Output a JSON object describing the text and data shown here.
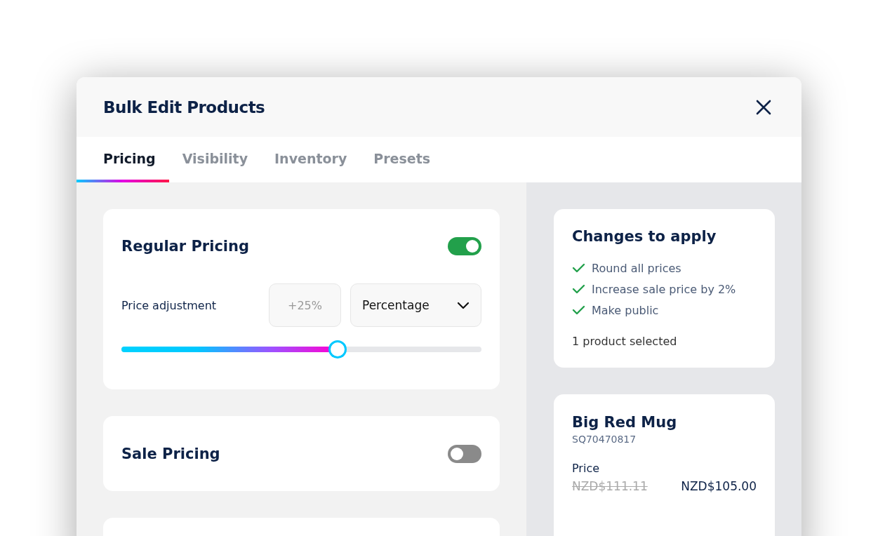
{
  "dialog": {
    "title": "Bulk Edit Products"
  },
  "tabs": [
    {
      "label": "Pricing",
      "selected": true
    },
    {
      "label": "Visibility",
      "selected": false
    },
    {
      "label": "Inventory",
      "selected": false
    },
    {
      "label": "Presets",
      "selected": false
    }
  ],
  "sections": [
    {
      "kind": "adjustment",
      "title": "Regular Pricing",
      "on": true,
      "adjustment_label": "Price adjustment",
      "amount": {
        "placeholder": "+25%"
      },
      "mode": "Percentage",
      "slider": {
        "level": 0.6
      }
    },
    {
      "kind": "toggle",
      "title": "Sale Pricing",
      "on": false
    },
    {
      "kind": "blank"
    }
  ],
  "summary": {
    "title": "Changes to apply",
    "changes": [
      "Round all prices",
      "Increase sale price by 2%",
      "Make public"
    ],
    "footer": "1 product selected"
  },
  "product": {
    "name": "Big Red Mug",
    "sku": "SQ70470817",
    "price_label": "Price",
    "old_price": "NZD$111.11",
    "new_price": "NZD$105.00"
  }
}
